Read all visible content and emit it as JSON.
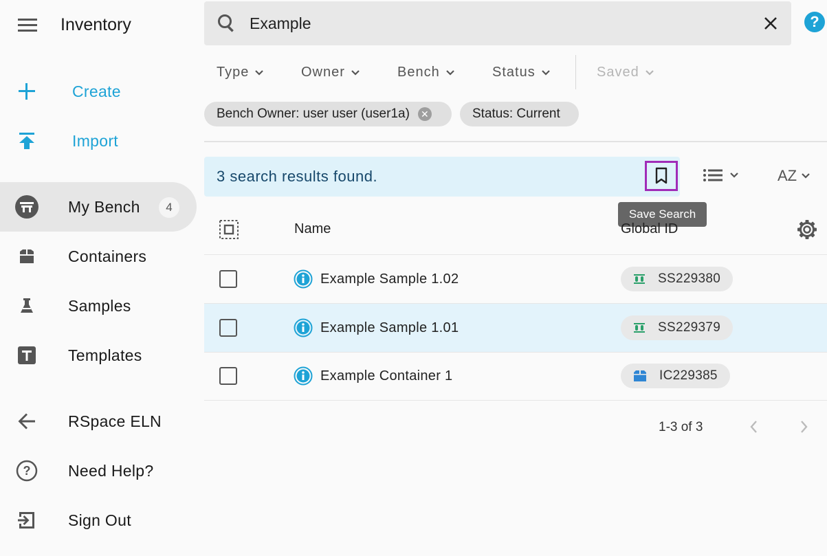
{
  "sidebar": {
    "app_title": "Inventory",
    "create_label": "Create",
    "import_label": "Import",
    "items": [
      {
        "label": "My Bench",
        "badge": "4",
        "icon": "bench-icon"
      },
      {
        "label": "Containers",
        "icon": "container-box-icon"
      },
      {
        "label": "Samples",
        "icon": "flask-icon"
      },
      {
        "label": "Templates",
        "icon": "template-t-icon"
      },
      {
        "label": "RSpace ELN",
        "icon": "arrow-back-icon"
      },
      {
        "label": "Need Help?",
        "icon": "help-circle-icon"
      },
      {
        "label": "Sign Out",
        "icon": "sign-out-icon"
      }
    ],
    "accent_color": "#1ea3d6"
  },
  "search": {
    "value": "Example",
    "clear_icon": "close-icon",
    "search_icon": "search-icon",
    "help_label": "?"
  },
  "filters": {
    "type": "Type",
    "owner": "Owner",
    "bench": "Bench",
    "status": "Status",
    "saved": "Saved"
  },
  "chips": {
    "bench_owner": "Bench Owner: user user (user1a)",
    "status": "Status: Current"
  },
  "results": {
    "message": "3 search results found.",
    "save_tooltip": "Save Search",
    "sort_label": "AZ"
  },
  "table": {
    "headers": {
      "name": "Name",
      "global_id": "Global ID"
    },
    "rows": [
      {
        "name": "Example Sample 1.02",
        "global_id": "SS229380",
        "kind": "sample",
        "selected": false
      },
      {
        "name": "Example Sample 1.01",
        "global_id": "SS229379",
        "kind": "sample",
        "selected": true
      },
      {
        "name": "Example Container 1",
        "global_id": "IC229385",
        "kind": "container",
        "selected": false
      }
    ]
  },
  "pagination": {
    "range": "1-3 of 3"
  }
}
